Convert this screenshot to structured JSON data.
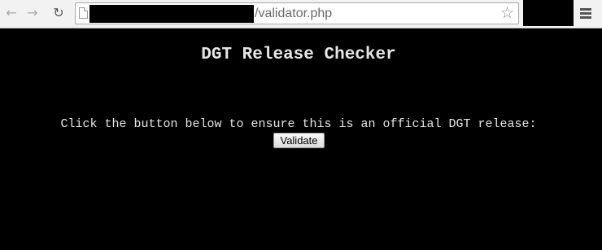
{
  "browser": {
    "back_icon": "back-arrow-icon",
    "forward_icon": "forward-arrow-icon",
    "reload_icon": "reload-icon",
    "url_visible": "/validator.php",
    "bookmark_icon": "star-icon",
    "menu_icon": "hamburger-menu-icon"
  },
  "page": {
    "title": "DGT Release Checker",
    "instruction": "Click the button below to ensure this is an official DGT release:",
    "validate_label": "Validate"
  },
  "colors": {
    "page_background": "#000000",
    "text": "#e6e6e6"
  }
}
